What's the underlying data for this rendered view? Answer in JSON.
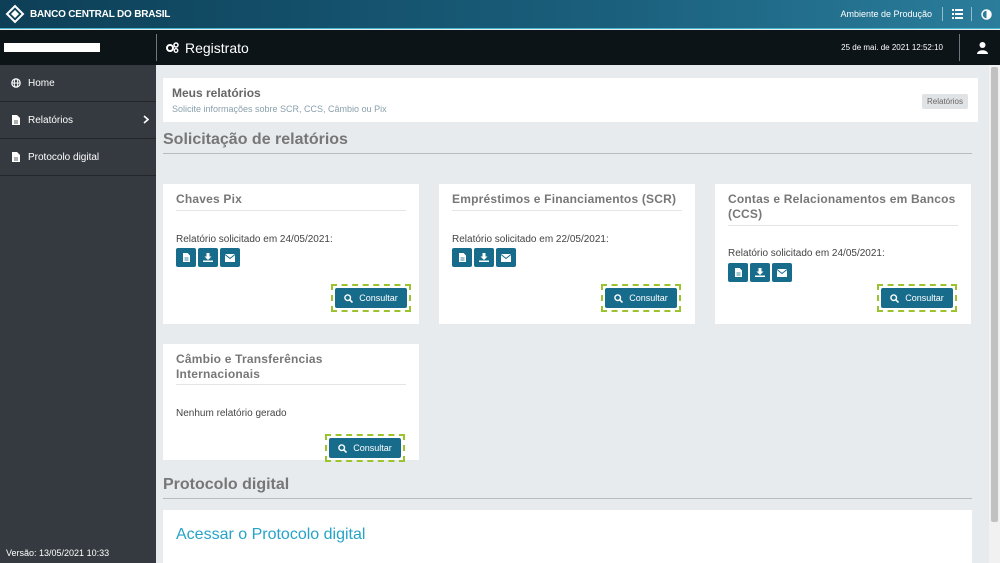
{
  "topbar": {
    "brand_name": "BANCO CENTRAL DO BRASIL",
    "environment": "Ambiente de Produção"
  },
  "secondbar": {
    "app_title": "Registrato",
    "datetime": "25 de mai. de 2021 12:52:10"
  },
  "sidebar": {
    "items": [
      {
        "label": "Home",
        "icon": "globe-icon"
      },
      {
        "label": "Relatórios",
        "icon": "file-icon"
      },
      {
        "label": "Protocolo digital",
        "icon": "file-icon"
      }
    ],
    "version": "Versão:  13/05/2021 10:33"
  },
  "header": {
    "title": "Meus relatórios",
    "subtitle": "Solicite informações sobre SCR, CCS, Câmbio ou Pix",
    "badge": "Relatórios"
  },
  "sections": {
    "reports_title": "Solicitação de relatórios",
    "protocol_title": "Protocolo digital"
  },
  "cards": [
    {
      "title": "Chaves Pix",
      "status": "Relatório solicitado em 24/05/2021:",
      "button": "Consultar"
    },
    {
      "title": "Empréstimos e Financiamentos (SCR)",
      "status": "Relatório solicitado em 22/05/2021:",
      "button": "Consultar"
    },
    {
      "title": "Contas e Relacionamentos em Bancos (CCS)",
      "status": "Relatório solicitado em 24/05/2021:",
      "button": "Consultar"
    },
    {
      "title": "Câmbio e Transferências Internacionais",
      "status": "Nenhum relatório gerado",
      "button": "Consultar"
    }
  ],
  "protocol": {
    "link": "Acessar o Protocolo digital"
  },
  "colors": {
    "primary_button": "#176c8c",
    "focus_outline": "#9ac32e",
    "sidebar_bg": "#343a40",
    "link": "#26a3c8"
  }
}
